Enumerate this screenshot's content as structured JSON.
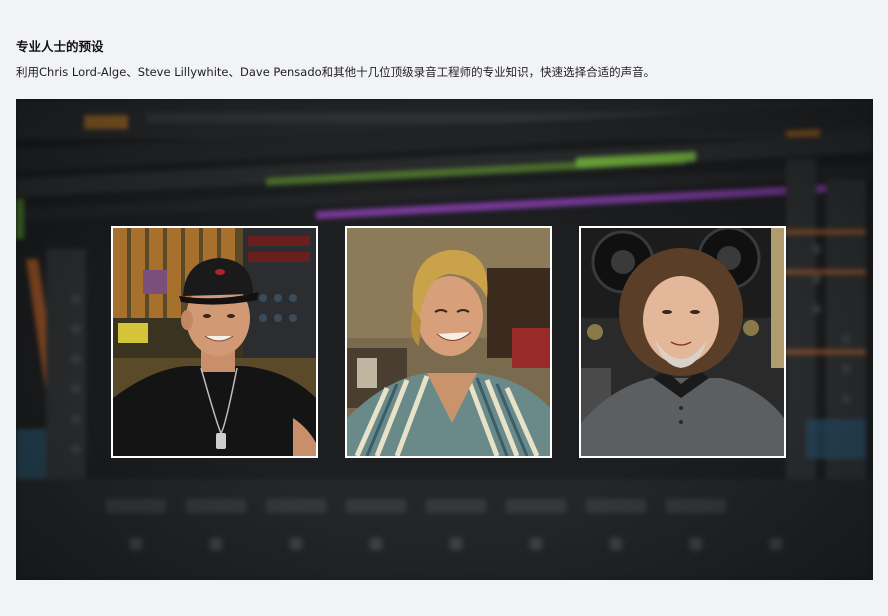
{
  "section": {
    "title": "专业人士的预设",
    "description": "利用Chris Lord-Alge、Steve Lillywhite、Dave Pensado和其他十几位顶级录音工程师的专业知识，快速选择合适的声音。"
  },
  "hero": {
    "background": "blurred-mixer-console-screenshot",
    "photos": [
      {
        "icon": "engineer-portrait-cap-black-shirt"
      },
      {
        "icon": "engineer-portrait-striped-shirt"
      },
      {
        "icon": "engineer-portrait-grey-polo"
      }
    ]
  },
  "colors": {
    "page_bg": "#f2f3f7",
    "photo_border": "#ffffff",
    "console_dark": "#1b1d1f",
    "accent_orange": "#e07a2c",
    "accent_green": "#6fae3a",
    "accent_purple": "#8a3fb0"
  }
}
